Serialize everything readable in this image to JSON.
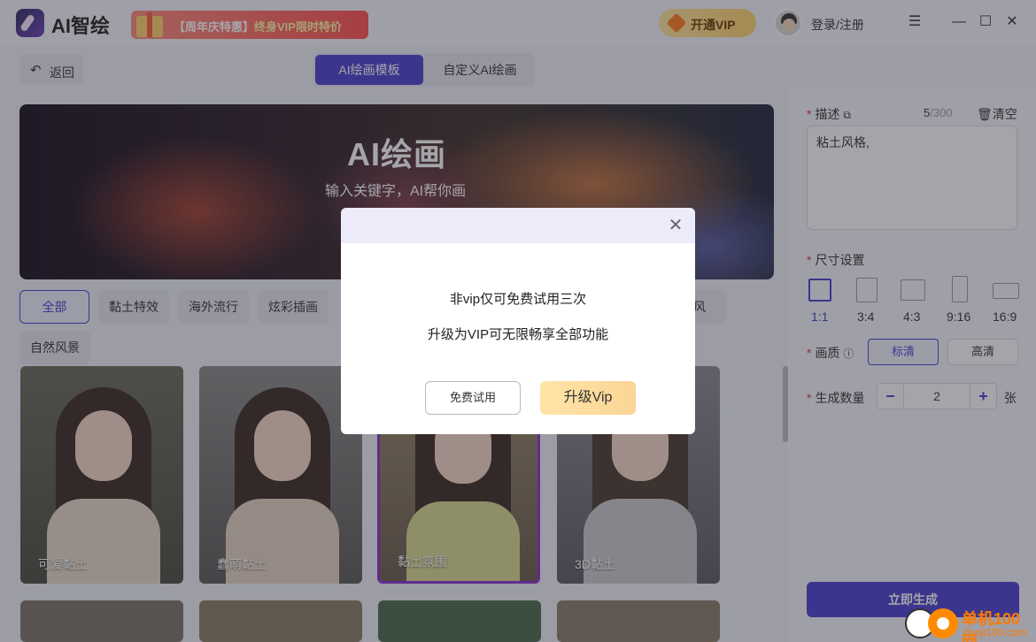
{
  "app": {
    "name": "AI智绘",
    "promo_tag": "【周年庆特惠】",
    "promo_text": "终身VIP限时特价",
    "vip_button": "开通VIP",
    "login": "登录/注册"
  },
  "toolbar": {
    "back": "返回",
    "tabs": [
      "AI绘画模板",
      "自定义AI绘画"
    ]
  },
  "banner": {
    "title": "AI绘画",
    "subtitle": "输入关键字，AI帮你画"
  },
  "categories": [
    "全部",
    "黏土特效",
    "海外流行",
    "炫彩插画",
    "风",
    "自然风景"
  ],
  "cards": [
    {
      "label": "可爱黏土"
    },
    {
      "label": "蠢萌黏土"
    },
    {
      "label": "黏土氛围"
    },
    {
      "label": "3D黏土"
    }
  ],
  "panel": {
    "desc_label": "描述",
    "desc_count": "5",
    "desc_max": "/300",
    "clear": "清空",
    "desc_value": "粘土风格,",
    "size_label": "尺寸设置",
    "sizes": [
      "1:1",
      "3:4",
      "4:3",
      "9:16",
      "16:9"
    ],
    "quality_label": "画质",
    "quality_options": [
      "标清",
      "高清"
    ],
    "count_label": "生成数量",
    "count_value": "2",
    "count_unit": "张",
    "generate": "立即生成"
  },
  "modal": {
    "line1": "非vip仅可免费试用三次",
    "line2": "升级为VIP可无限畅享全部功能",
    "trial": "免费试用",
    "upgrade": "升级Vip"
  },
  "watermark": {
    "title": "单机100网",
    "url": "danji100.com"
  },
  "colors": {
    "accent": "#4a3fd0",
    "vip_gold": "#ffd36b",
    "promo_red": "#ff4f4f"
  }
}
